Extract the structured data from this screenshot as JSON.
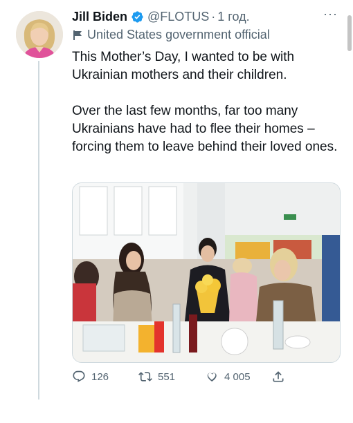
{
  "tweet": {
    "author": {
      "display_name": "Jill Biden",
      "handle": "@FLOTUS",
      "separator": "·",
      "time": "1 год.",
      "verified_color": "#1d9bf0"
    },
    "more_label": "···",
    "account_label": "United States government official",
    "text": {
      "paragraph_1": "This Mother’s Day, I wanted to be with Ukrainian mothers and their children.",
      "paragraph_2": "Over the last few months, far too many Ukrainians have had to flee their homes – forcing them to leave behind their loved ones."
    },
    "actions": {
      "reply_count": "126",
      "retweet_count": "551",
      "like_count": "4 005",
      "icons": [
        "reply-icon",
        "retweet-icon",
        "like-icon",
        "share-icon"
      ]
    }
  },
  "colors": {
    "text": "#0f1419",
    "secondary": "#536471",
    "accent": "#1d9bf0"
  }
}
